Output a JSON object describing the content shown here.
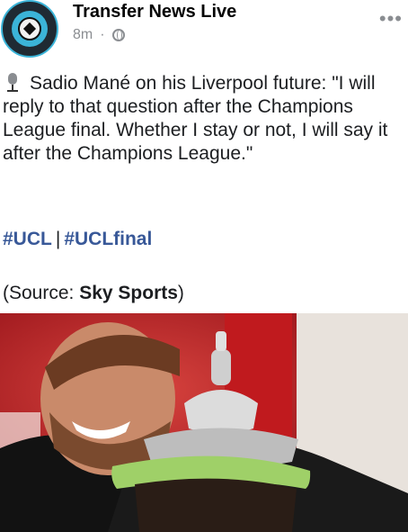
{
  "header": {
    "page_name": "Transfer News Live",
    "time_ago": "8m",
    "separator": "·",
    "privacy_icon": "globe-icon",
    "more_icon": "more-icon",
    "more_glyph": "•••"
  },
  "post": {
    "emoji_icon": "microphone-icon",
    "text": "Sadio Mané on his Liverpool future: \"I will reply to that question after the Champions League final. Whether I stay or not, I will say it after the Champions League.\"",
    "hashtags": [
      "#UCL",
      "#UCLfinal"
    ],
    "hashtag_separator": "|",
    "source_prefix": "(Source: ",
    "source_name": "Sky Sports",
    "source_suffix": ")"
  },
  "colors": {
    "hashtag": "#385898",
    "meta": "#8a8d91",
    "avatar_ring": "#3bb4d8",
    "photo_background": "#b80d18"
  }
}
